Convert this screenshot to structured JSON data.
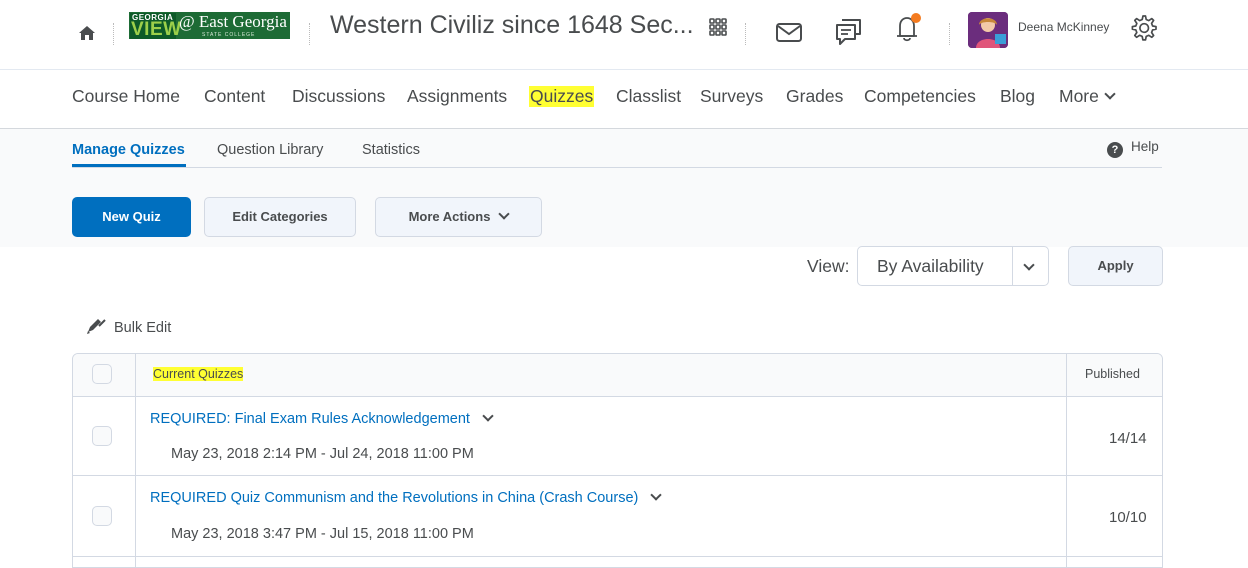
{
  "minibar": {
    "logo": {
      "top": "GEORGIA",
      "view": "VIEW",
      "name": "@ East Georgia",
      "sub": "STATE COLLEGE"
    },
    "course_title": "Western Civiliz since 1648 Sec...",
    "user_name": "Deena McKinney"
  },
  "navbar": {
    "items": [
      "Course Home",
      "Content",
      "Discussions",
      "Assignments",
      "Quizzes",
      "Classlist",
      "Surveys",
      "Grades",
      "Competencies",
      "Blog"
    ],
    "more_label": "More",
    "highlight_color": "#ffff33"
  },
  "subtabs": {
    "items": [
      "Manage Quizzes",
      "Question Library",
      "Statistics"
    ],
    "help_label": "Help"
  },
  "actions": {
    "new_quiz": "New Quiz",
    "edit_categories": "Edit Categories",
    "more_actions": "More Actions"
  },
  "view": {
    "label": "View:",
    "selected": "By Availability",
    "apply": "Apply"
  },
  "bulk_edit": "Bulk Edit",
  "table": {
    "header_title": "Current Quizzes",
    "header_published": "Published",
    "rows": [
      {
        "title": "REQUIRED: Final Exam Rules Acknowledgement",
        "dates": "May 23, 2018 2:14 PM - Jul 24, 2018 11:00 PM",
        "published": "14/14"
      },
      {
        "title": "REQUIRED Quiz Communism and the Revolutions in China (Crash Course)",
        "dates": "May 23, 2018 3:47 PM - Jul 15, 2018 11:00 PM",
        "published": "10/10"
      }
    ]
  },
  "colors": {
    "primary": "#006fbf",
    "notification": "#f47b1f",
    "text": "#494c4e"
  }
}
